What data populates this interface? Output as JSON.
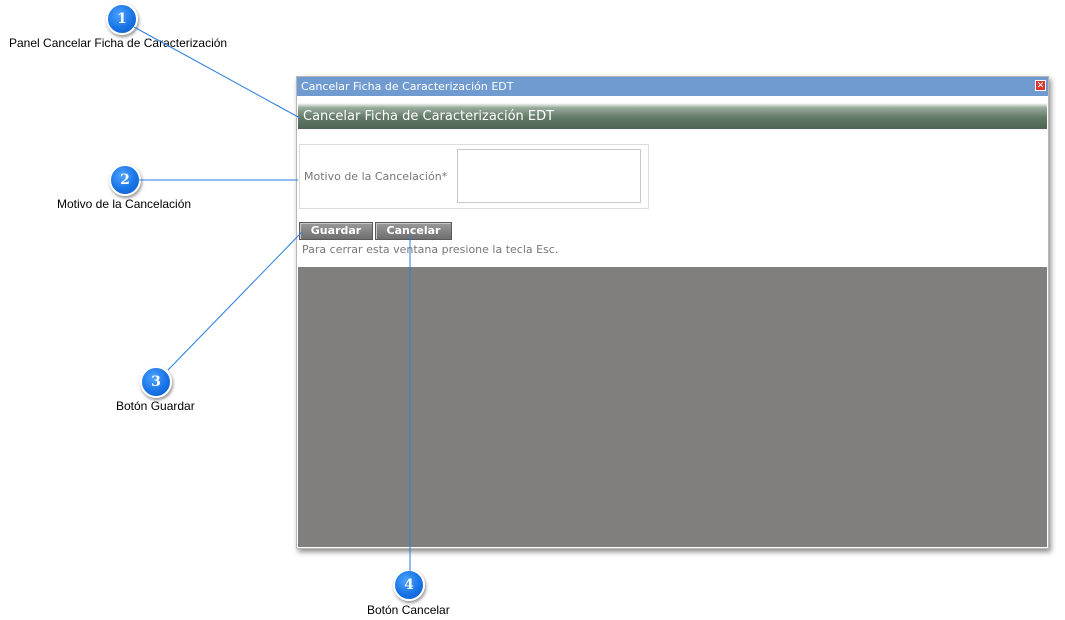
{
  "window": {
    "title": "Cancelar Ficha de Caracterización EDT",
    "close_icon": "close-icon",
    "panel_title": "Cancelar Ficha de Caracterización EDT",
    "field_label": "Motivo de la Cancelación*",
    "field_value": "",
    "save_label": "Guardar",
    "cancel_label": "Cancelar",
    "hint": "Para cerrar esta ventana presione la tecla Esc."
  },
  "callouts": [
    {
      "number": "1",
      "caption": "Panel Cancelar Ficha de Caracterización"
    },
    {
      "number": "2",
      "caption": "Motivo de la Cancelación"
    },
    {
      "number": "3",
      "caption": "Botón Guardar"
    },
    {
      "number": "4",
      "caption": "Botón Cancelar"
    }
  ],
  "colors": {
    "titlebar": "#6f9bd1",
    "callout_blue": "#1874e6",
    "leader_line": "#2a7de1",
    "modal_gray": "#807f7d"
  }
}
